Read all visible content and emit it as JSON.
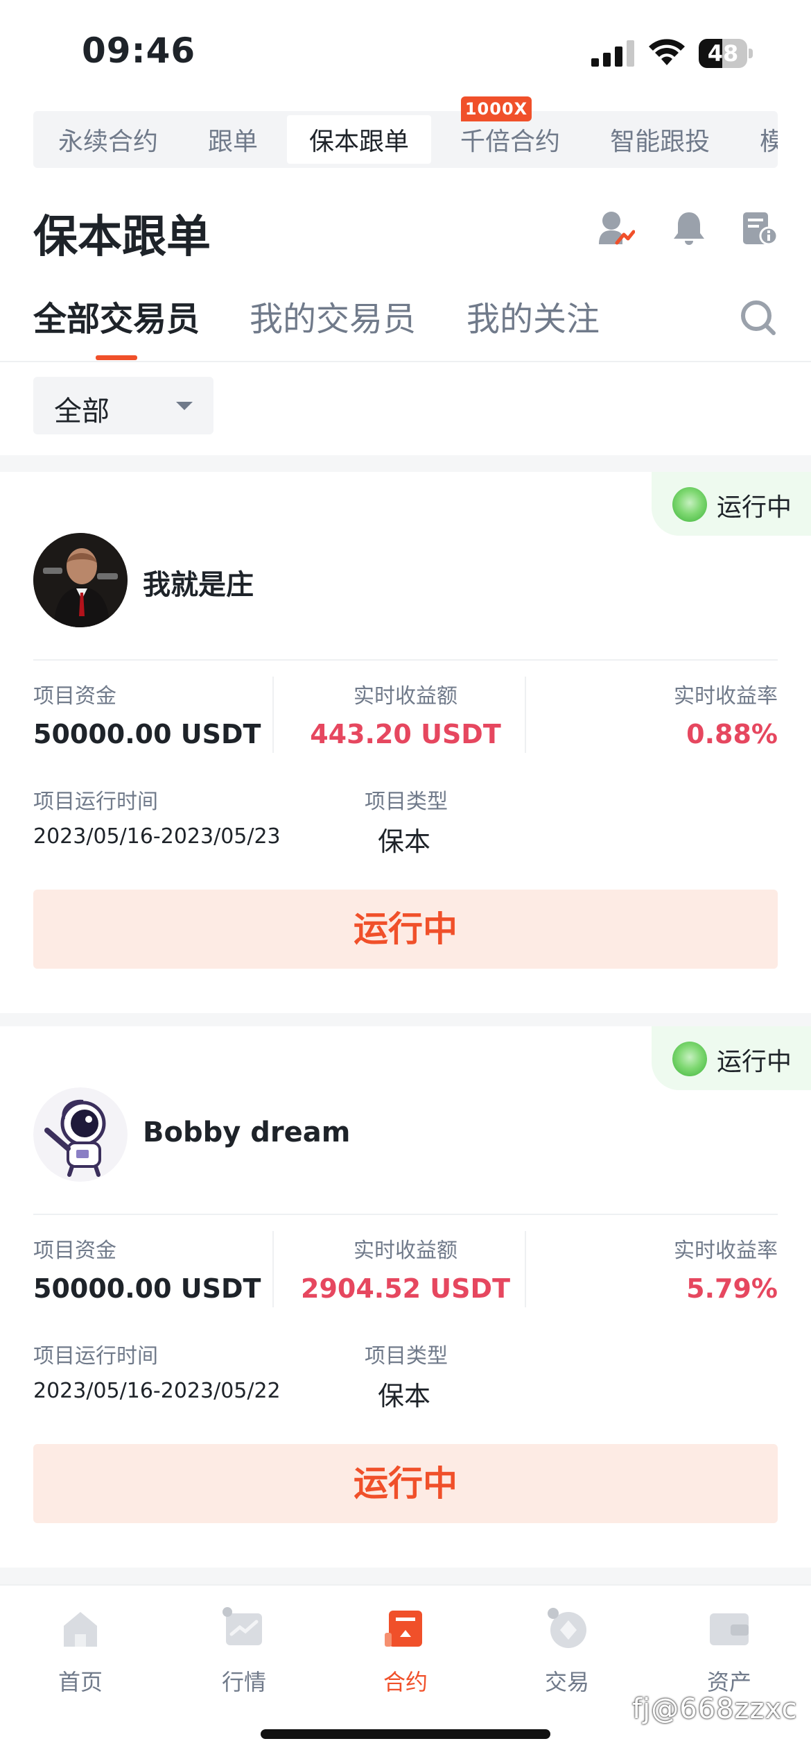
{
  "status_bar": {
    "time": "09:46",
    "battery": "48",
    "battery_level": 0.48
  },
  "top_tabs": {
    "items": [
      {
        "label": "永续合约"
      },
      {
        "label": "跟单"
      },
      {
        "label": "保本跟单",
        "active": true
      },
      {
        "label": "千倍合约"
      },
      {
        "label": "智能跟投"
      },
      {
        "label": "模拟合"
      }
    ],
    "badge": "1000X"
  },
  "header": {
    "title": "保本跟单",
    "icons": [
      "trader-profile-icon",
      "bell-icon",
      "document-info-icon"
    ]
  },
  "sub_tabs": {
    "items": [
      {
        "label": "全部交易员",
        "active": true
      },
      {
        "label": "我的交易员"
      },
      {
        "label": "我的关注"
      }
    ]
  },
  "filter": {
    "selected": "全部"
  },
  "cards": [
    {
      "status": "运行中",
      "name": "我就是庄",
      "capital_label": "项目资金",
      "capital": "50000.00 USDT",
      "profit_label": "实时收益额",
      "profit": "443.20 USDT",
      "rate_label": "实时收益率",
      "rate": "0.88%",
      "period_label": "项目运行时间",
      "period": "2023/05/16-2023/05/23",
      "type_label": "项目类型",
      "type": "保本",
      "button": "运行中"
    },
    {
      "status": "运行中",
      "name": "Bobby dream",
      "capital_label": "项目资金",
      "capital": "50000.00 USDT",
      "profit_label": "实时收益额",
      "profit": "2904.52 USDT",
      "rate_label": "实时收益率",
      "rate": "5.79%",
      "period_label": "项目运行时间",
      "period": "2023/05/16-2023/05/22",
      "type_label": "项目类型",
      "type": "保本",
      "button": "运行中"
    }
  ],
  "bottom_nav": {
    "items": [
      {
        "label": "首页"
      },
      {
        "label": "行情"
      },
      {
        "label": "合约",
        "active": true
      },
      {
        "label": "交易"
      },
      {
        "label": "资产"
      }
    ]
  },
  "watermark": "fj@668zzxc",
  "colors": {
    "accent": "#f0502a",
    "profit": "#e6475f",
    "running_green": "#3db33a"
  }
}
